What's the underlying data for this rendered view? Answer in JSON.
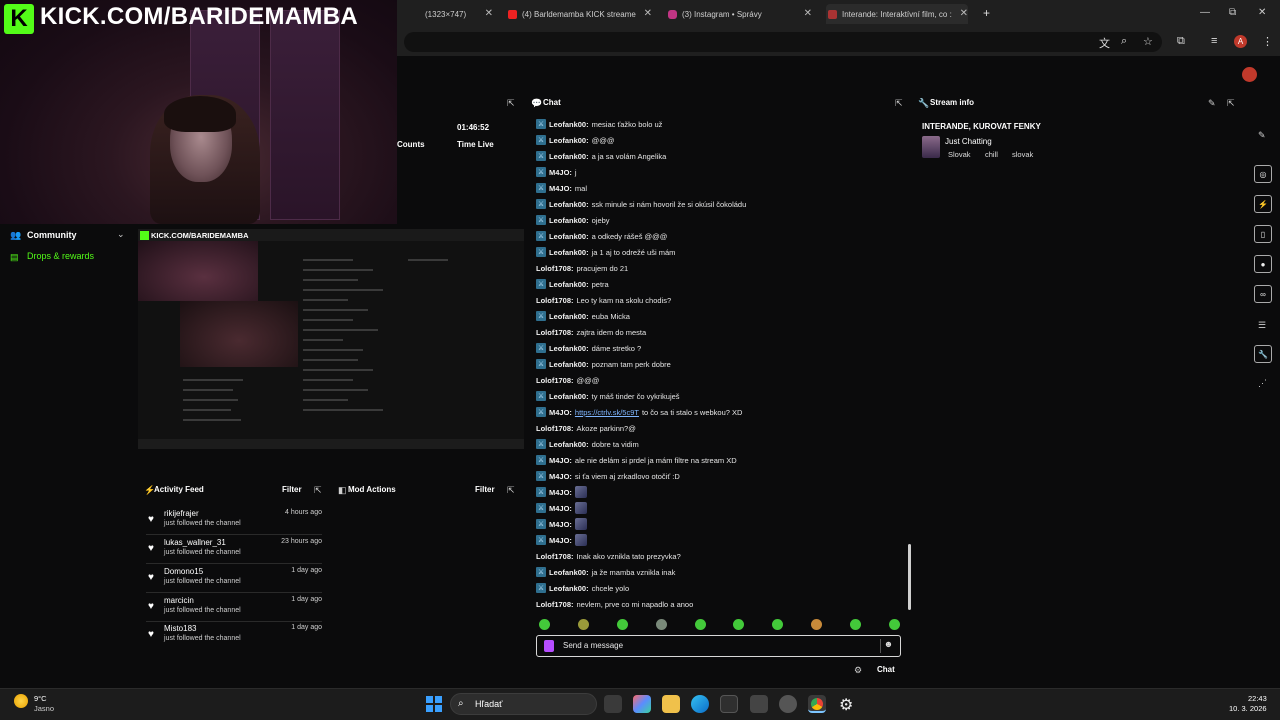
{
  "browser": {
    "tabs": [
      {
        "label": "(1323×747)",
        "icon": "generic-tab-icon"
      },
      {
        "label": "(4) Barldemamba KICK streame",
        "icon": "youtube-icon"
      },
      {
        "label": "(3) Instagram • Správy",
        "icon": "instagram-icon"
      },
      {
        "label": "Interande: Interaktívní film, co :",
        "icon": "tab-icon"
      }
    ],
    "new_tab": "+",
    "window_controls": [
      "—",
      "⧉",
      "✕"
    ],
    "avatar_letter": "A"
  },
  "overlay": {
    "url_text": "KICK.COM/BARIDEMAMBA",
    "logo_letter": "K"
  },
  "sidebar": {
    "community": "Community",
    "drops": "Drops & rewards"
  },
  "stats": {
    "uptime": "01:46:52",
    "counts_label": "Counts",
    "time_live_label": "Time Live"
  },
  "preview": {
    "url_text": "KICK.COM/BARIDEMAMBA"
  },
  "activity_feed": {
    "title": "Activity Feed",
    "filter": "Filter",
    "items": [
      {
        "name": "rikijefrajer",
        "sub": "just followed the channel",
        "time": "4 hours ago"
      },
      {
        "name": "lukas_wallner_31",
        "sub": "just followed the channel",
        "time": "23 hours ago"
      },
      {
        "name": "Domono15",
        "sub": "just followed the channel",
        "time": "1 day ago"
      },
      {
        "name": "marcicin",
        "sub": "just followed the channel",
        "time": "1 day ago"
      },
      {
        "name": "Misto183",
        "sub": "just followed the channel",
        "time": "1 day ago"
      }
    ]
  },
  "mod_actions": {
    "title": "Mod Actions",
    "filter": "Filter"
  },
  "chat": {
    "title": "Chat",
    "messages": [
      {
        "badge": true,
        "user": "Leofank00:",
        "text": "mesiac ťažko bolo už"
      },
      {
        "badge": true,
        "user": "Leofank00:",
        "text": "@@@"
      },
      {
        "badge": true,
        "user": "Leofank00:",
        "text": "a ja sa volám Angelika"
      },
      {
        "badge": true,
        "user": "M4JO:",
        "text": "j"
      },
      {
        "badge": true,
        "user": "M4JO:",
        "text": "mal"
      },
      {
        "badge": true,
        "user": "Leofank00:",
        "text": "ssk minule si nám hovoril že si okúsil čokoládu"
      },
      {
        "badge": true,
        "user": "Leofank00:",
        "text": "ojeby"
      },
      {
        "badge": true,
        "user": "Leofank00:",
        "text": "a odkedy rášeš @@@"
      },
      {
        "badge": true,
        "user": "Leofank00:",
        "text": "ja 1 aj to odrežé uši mám"
      },
      {
        "badge": false,
        "user": "Lolof1708:",
        "text": "pracujem do 21"
      },
      {
        "badge": true,
        "user": "Leofank00:",
        "text": "petra"
      },
      {
        "badge": false,
        "user": "Lolof1708:",
        "text": "Leo ty kam na skolu chodis?"
      },
      {
        "badge": true,
        "user": "Leofank00:",
        "text": "euba Micka"
      },
      {
        "badge": false,
        "user": "Lolof1708:",
        "text": "zajtra idem do mesta"
      },
      {
        "badge": true,
        "user": "Leofank00:",
        "text": "dáme stretko ?"
      },
      {
        "badge": true,
        "user": "Leofank00:",
        "text": "poznam tam perk dobre"
      },
      {
        "badge": false,
        "user": "Lolof1708:",
        "text": "@@@"
      },
      {
        "badge": true,
        "user": "Leofank00:",
        "text": "ty máš tinder čo vykrikuješ"
      },
      {
        "badge": true,
        "user": "M4JO:",
        "text": "to čo sa ti stalo s webkou? XD",
        "link": "https://ctrlv.sk/5c9T"
      },
      {
        "badge": false,
        "user": "Lolof1708:",
        "text": "Akoze parkinn?@"
      },
      {
        "badge": true,
        "user": "Leofank00:",
        "text": "dobre ta vidim"
      },
      {
        "badge": true,
        "user": "M4JO:",
        "text": "ale nie delám si prdel ja mám filtre na stream XD"
      },
      {
        "badge": true,
        "user": "M4JO:",
        "text": "si ťa viem aj zrkadlovo otočiť :D"
      },
      {
        "badge": true,
        "user": "M4JO:",
        "text": "",
        "emote": true
      },
      {
        "badge": true,
        "user": "M4JO:",
        "text": "",
        "emote": true
      },
      {
        "badge": true,
        "user": "M4JO:",
        "text": "",
        "emote": true
      },
      {
        "badge": true,
        "user": "M4JO:",
        "text": "",
        "emote": true
      },
      {
        "badge": false,
        "user": "Lolof1708:",
        "text": "Inak ako vznikla tato prezyvka?"
      },
      {
        "badge": true,
        "user": "Leofank00:",
        "text": "ja že mamba vznikla inak"
      },
      {
        "badge": true,
        "user": "Leofank00:",
        "text": "chcele yolo"
      },
      {
        "badge": false,
        "user": "Lolof1708:",
        "text": "nevlem, prve co mi napadlo a anoo"
      }
    ],
    "input_placeholder": "Send a message",
    "send_label": "Chat"
  },
  "stream_info": {
    "title_label": "Stream info",
    "stream_title": "INTERANDE, KUROVAT FENKY",
    "category": "Just Chatting",
    "tags": [
      "Slovak",
      "chill",
      "slovak"
    ]
  },
  "taskbar": {
    "weather_temp": "9°C",
    "weather_desc": "Jasno",
    "search_placeholder": "Hľadať",
    "time": "22:43",
    "date": "10. 3. 2026"
  },
  "colors": {
    "kick_green": "#53fc18",
    "background": "#0b0b0c",
    "link": "#7fb6ff"
  }
}
